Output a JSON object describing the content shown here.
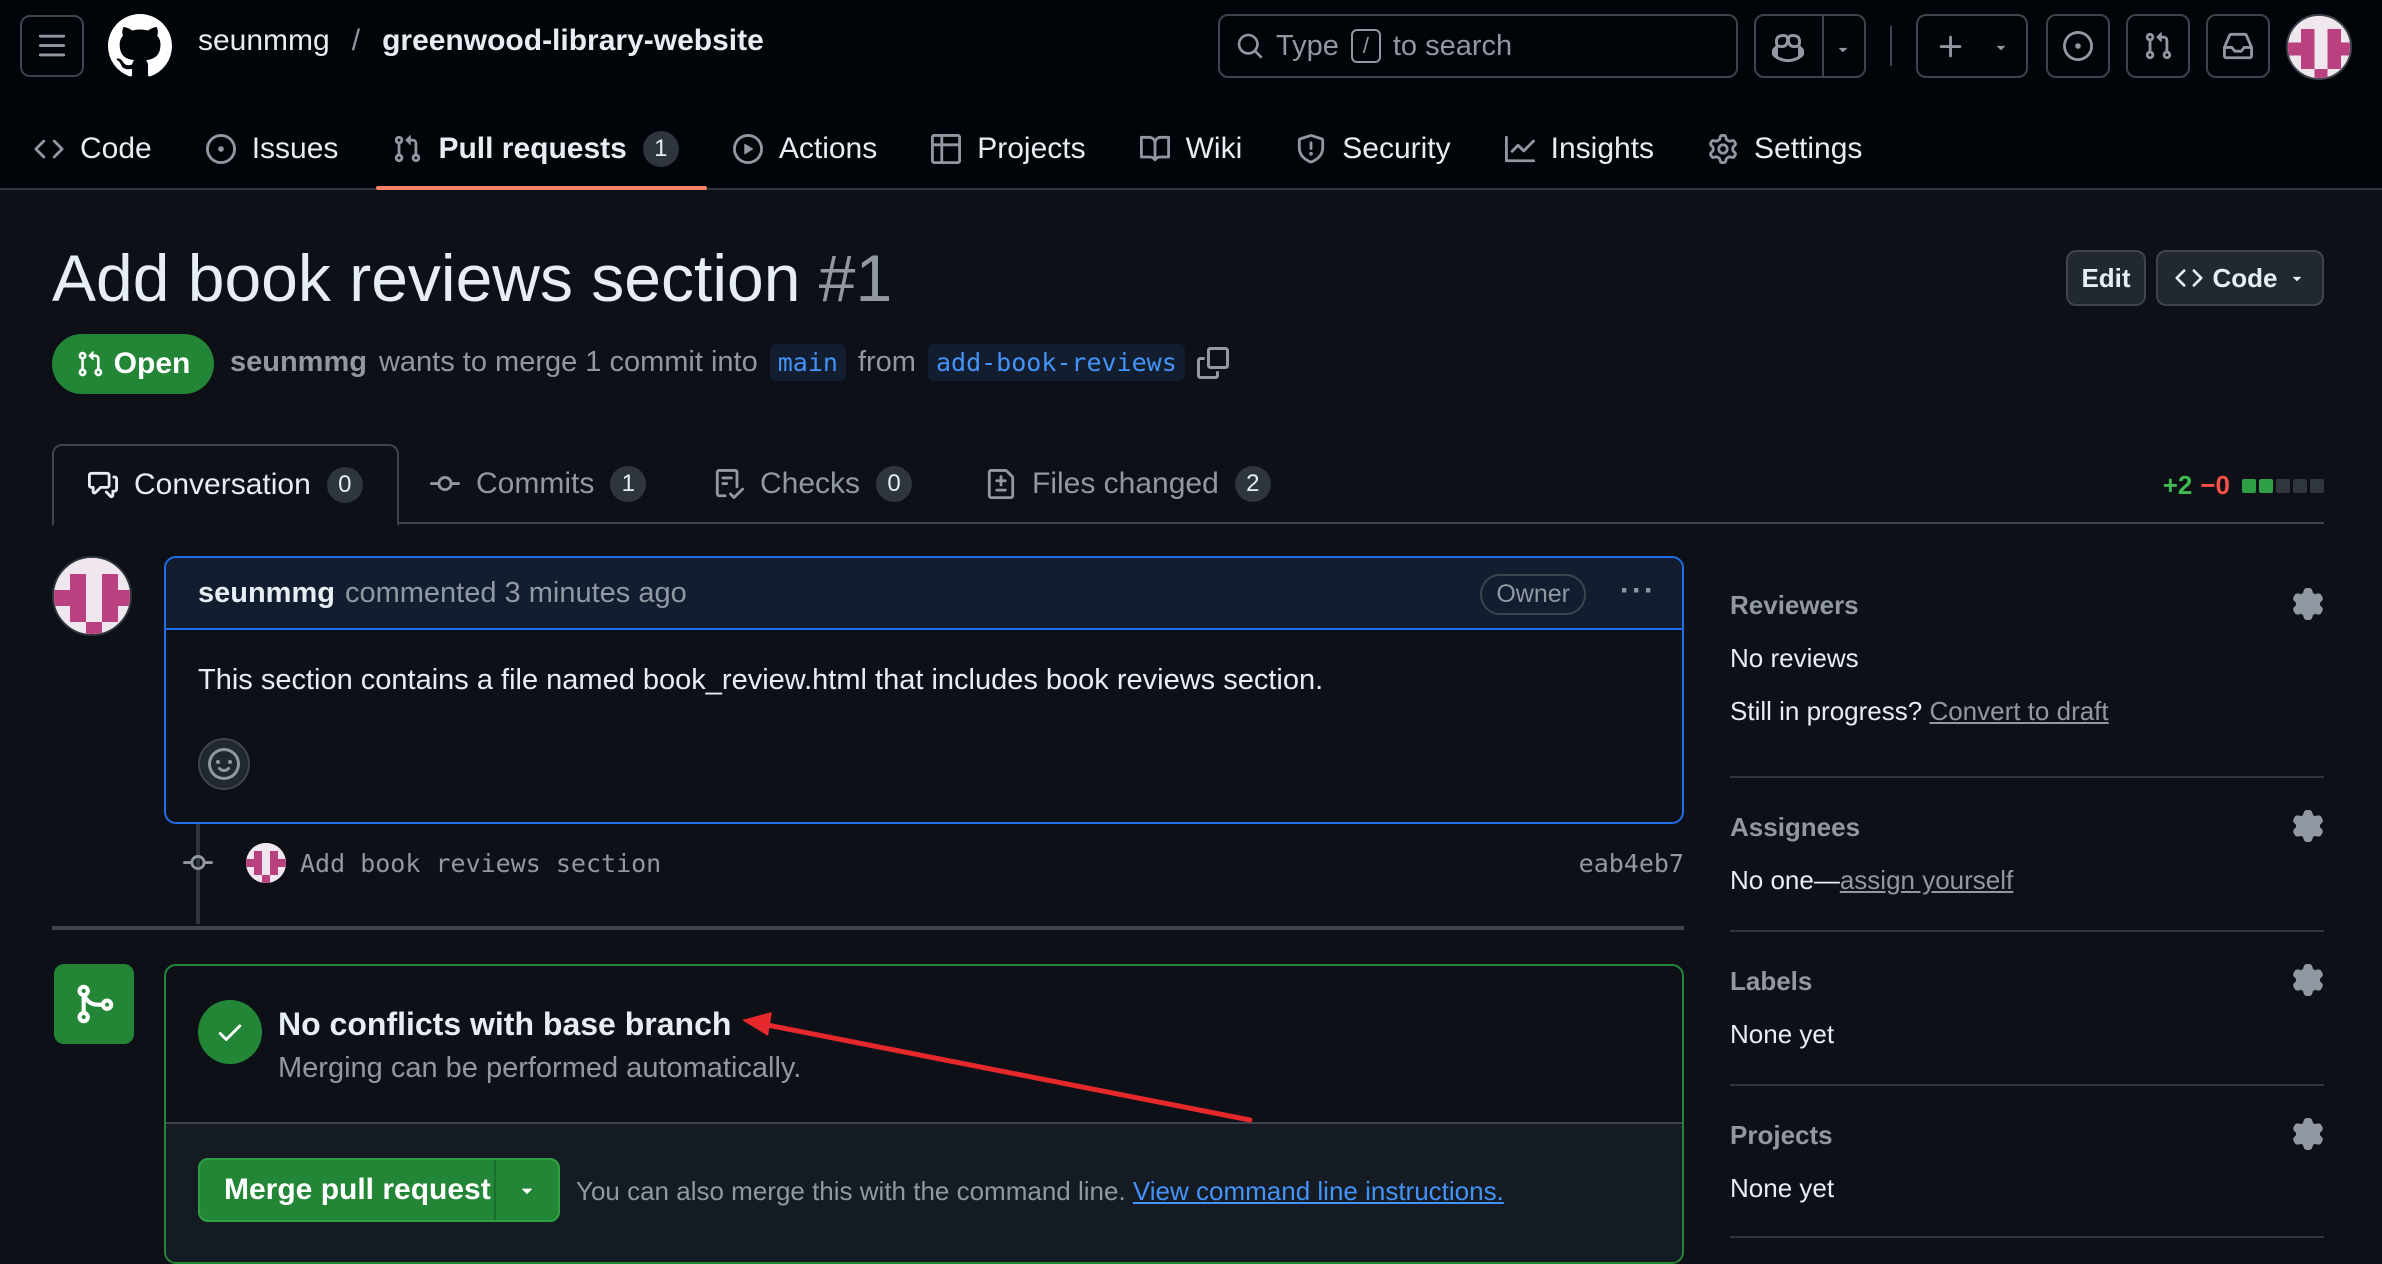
{
  "header": {
    "owner": "seunmmg",
    "separator": "/",
    "repo": "greenwood-library-website",
    "search_prefix": "Type",
    "search_key": "/",
    "search_suffix": "to search"
  },
  "repo_nav": [
    {
      "label": "Code",
      "icon": "code-icon"
    },
    {
      "label": "Issues",
      "icon": "issue-opened-icon"
    },
    {
      "label": "Pull requests",
      "icon": "git-pull-request-icon",
      "count": "1",
      "active": true
    },
    {
      "label": "Actions",
      "icon": "play-icon"
    },
    {
      "label": "Projects",
      "icon": "table-icon"
    },
    {
      "label": "Wiki",
      "icon": "book-icon"
    },
    {
      "label": "Security",
      "icon": "shield-icon"
    },
    {
      "label": "Insights",
      "icon": "graph-icon"
    },
    {
      "label": "Settings",
      "icon": "gear-icon"
    }
  ],
  "pr": {
    "title": "Add book reviews section",
    "number": "#1",
    "edit_label": "Edit",
    "code_label": "Code",
    "state": "Open",
    "author": "seunmmg",
    "meta_text": "wants to merge 1 commit into",
    "base": "main",
    "from_text": "from",
    "head": "add-book-reviews"
  },
  "tabs": [
    {
      "label": "Conversation",
      "count": "0",
      "icon": "comment-discussion-icon"
    },
    {
      "label": "Commits",
      "count": "1",
      "icon": "git-commit-icon"
    },
    {
      "label": "Checks",
      "count": "0",
      "icon": "checklist-icon"
    },
    {
      "label": "Files changed",
      "count": "2",
      "icon": "file-diff-icon"
    }
  ],
  "diffstat": {
    "additions": "+2",
    "deletions": "−0",
    "colors": [
      "#2ea043",
      "#2ea043",
      "#30363d",
      "#30363d",
      "#30363d"
    ]
  },
  "comment": {
    "author": "seunmmg",
    "action": "commented 3 minutes ago",
    "role": "Owner",
    "body": "This section contains a file named book_review.html that includes book reviews section."
  },
  "commit": {
    "message": "Add book reviews section",
    "sha": "eab4eb7"
  },
  "merge": {
    "title": "No conflicts with base branch",
    "subtitle": "Merging can be performed automatically.",
    "button": "Merge pull request",
    "cli_text": "You can also merge this with the command line.",
    "cli_link": "View command line instructions."
  },
  "sidebar": {
    "reviewers": {
      "heading": "Reviewers",
      "value": "No reviews",
      "draft_prompt": "Still in progress?",
      "draft_link": "Convert to draft"
    },
    "assignees": {
      "heading": "Assignees",
      "value_prefix": "No one—",
      "value_link": "assign yourself"
    },
    "labels": {
      "heading": "Labels",
      "value": "None yet"
    },
    "projects": {
      "heading": "Projects",
      "value": "None yet"
    }
  },
  "colors": {
    "accent_green": "#238636",
    "link_blue": "#4493f8",
    "tab_underline": "#f78166",
    "annotation_arrow": "#e5282c"
  }
}
